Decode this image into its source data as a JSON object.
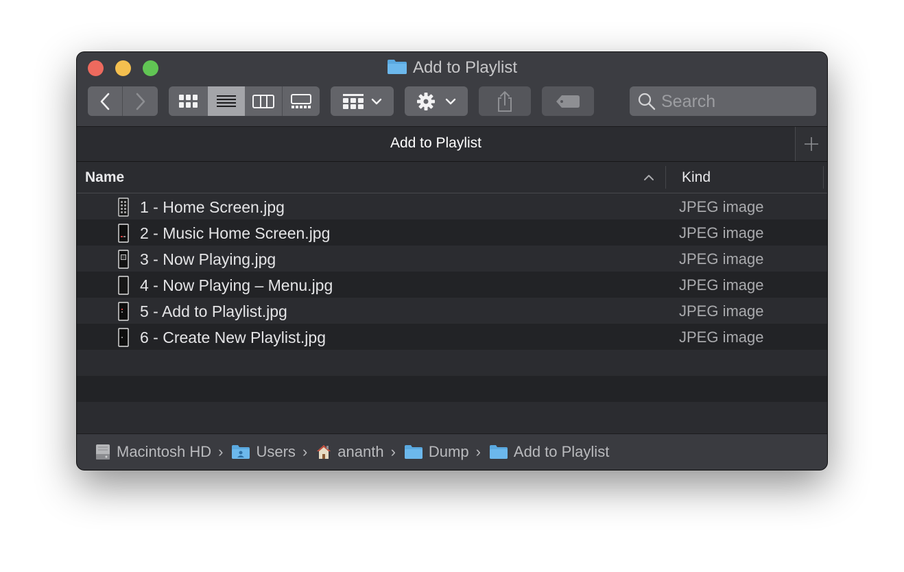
{
  "window": {
    "title": "Add to Playlist"
  },
  "toolbar": {
    "back_icon": "chevron-left-icon",
    "forward_icon": "chevron-right-icon",
    "search_placeholder": "Search"
  },
  "tabs": [
    {
      "label": "Add to Playlist"
    }
  ],
  "columns": {
    "name": "Name",
    "kind": "Kind"
  },
  "files": [
    {
      "name": "1 - Home Screen.jpg",
      "kind": "JPEG image"
    },
    {
      "name": "2 - Music Home Screen.jpg",
      "kind": "JPEG image"
    },
    {
      "name": "3 - Now Playing.jpg",
      "kind": "JPEG image"
    },
    {
      "name": "4 - Now Playing – Menu.jpg",
      "kind": "JPEG image"
    },
    {
      "name": "5 - Add to Playlist.jpg",
      "kind": "JPEG image"
    },
    {
      "name": "6 - Create New Playlist.jpg",
      "kind": "JPEG image"
    }
  ],
  "path": [
    {
      "label": "Macintosh HD",
      "icon": "hard-drive-icon"
    },
    {
      "label": "Users",
      "icon": "users-folder-icon"
    },
    {
      "label": "ananth",
      "icon": "home-icon"
    },
    {
      "label": "Dump",
      "icon": "folder-icon"
    },
    {
      "label": "Add to Playlist",
      "icon": "folder-icon"
    }
  ],
  "colors": {
    "window_bg": "#2b2c30",
    "toolbar_bg": "#3c3d42",
    "folder_blue": "#5aa9e0",
    "close": "#ed6a5e",
    "minimize": "#f4bf4f",
    "maximize": "#61c554"
  }
}
